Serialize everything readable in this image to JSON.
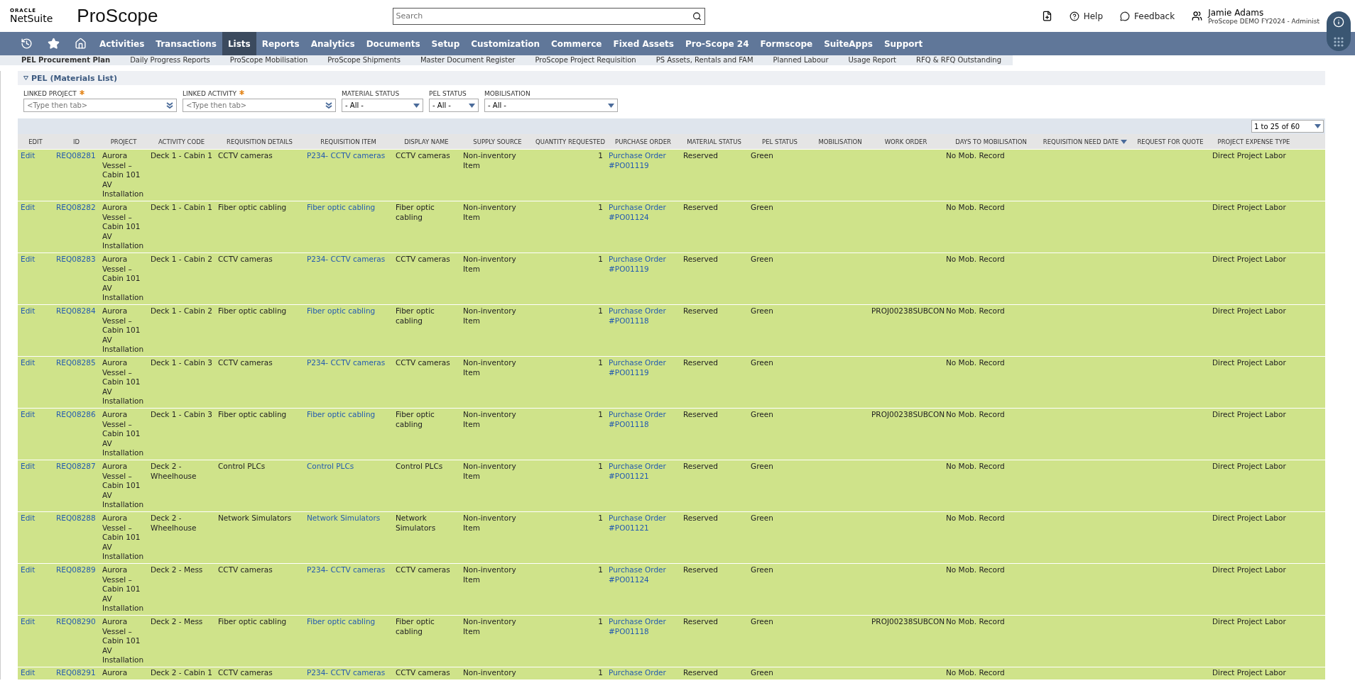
{
  "header": {
    "brand_top": "ORACLE",
    "brand_bottom": "NetSuite",
    "app_logo": "ProScope",
    "search": {
      "placeholder": "Search"
    },
    "help": "Help",
    "feedback": "Feedback",
    "user": {
      "name": "Jamie Adams",
      "role": "ProScope DEMO FY2024 - Administ"
    }
  },
  "nav": [
    {
      "label": "Activities",
      "selected": false
    },
    {
      "label": "Transactions",
      "selected": false
    },
    {
      "label": "Lists",
      "selected": true
    },
    {
      "label": "Reports",
      "selected": false
    },
    {
      "label": "Analytics",
      "selected": false
    },
    {
      "label": "Documents",
      "selected": false
    },
    {
      "label": "Setup",
      "selected": false
    },
    {
      "label": "Customization",
      "selected": false
    },
    {
      "label": "Commerce",
      "selected": false
    },
    {
      "label": "Fixed Assets",
      "selected": false
    },
    {
      "label": "Pro-Scope 24",
      "selected": false
    },
    {
      "label": "Formscope",
      "selected": false
    },
    {
      "label": "SuiteApps",
      "selected": false
    },
    {
      "label": "Support",
      "selected": false
    }
  ],
  "subnav": [
    {
      "label": "PEL Procurement Plan",
      "selected": true
    },
    {
      "label": "Daily Progress Reports",
      "selected": false
    },
    {
      "label": "ProScope Mobilisation",
      "selected": false
    },
    {
      "label": "ProScope Shipments",
      "selected": false
    },
    {
      "label": "Master Document Register",
      "selected": false
    },
    {
      "label": "ProScope Project Requisition",
      "selected": false
    },
    {
      "label": "PS Assets, Rentals and FAM",
      "selected": false
    },
    {
      "label": "Planned Labour",
      "selected": false
    },
    {
      "label": "Usage Report",
      "selected": false
    },
    {
      "label": "RFQ & RFQ Outstanding",
      "selected": false
    }
  ],
  "section": {
    "title": "PEL (Materials List)",
    "expanded": true
  },
  "filters": [
    {
      "label": "LINKED PROJECT",
      "required": true,
      "kind": "lookup",
      "placeholder": "<Type then tab>"
    },
    {
      "label": "LINKED ACTIVITY",
      "required": true,
      "kind": "lookup",
      "placeholder": "<Type then tab>"
    },
    {
      "label": "MATERIAL STATUS",
      "required": false,
      "kind": "select",
      "value": "- All -"
    },
    {
      "label": "PEL STATUS",
      "required": false,
      "kind": "select",
      "value": "- All -"
    },
    {
      "label": "MOBILISATION",
      "required": false,
      "kind": "select",
      "value": "- All -"
    }
  ],
  "pagination": "1 to 25 of 60",
  "table": {
    "columns": [
      {
        "label": "EDIT",
        "kind": "link"
      },
      {
        "label": "ID",
        "kind": "link"
      },
      {
        "label": "PROJECT",
        "kind": "text"
      },
      {
        "label": "ACTIVITY CODE",
        "kind": "text"
      },
      {
        "label": "REQUISITION DETAILS",
        "kind": "text"
      },
      {
        "label": "REQUISITION ITEM",
        "kind": "link"
      },
      {
        "label": "DISPLAY NAME",
        "kind": "text"
      },
      {
        "label": "SUPPLY SOURCE",
        "kind": "text"
      },
      {
        "label": "QUANTITY REQUESTED",
        "kind": "number"
      },
      {
        "label": "PURCHASE ORDER",
        "kind": "link"
      },
      {
        "label": "MATERIAL STATUS",
        "kind": "text"
      },
      {
        "label": "PEL STATUS",
        "kind": "text"
      },
      {
        "label": "MOBILISATION",
        "kind": "text"
      },
      {
        "label": "WORK ORDER",
        "kind": "text"
      },
      {
        "label": "DAYS TO MOBILISATION",
        "kind": "text"
      },
      {
        "label": "REQUISITION NEED DATE",
        "kind": "text",
        "sorted": true
      },
      {
        "label": "REQUEST FOR QUOTE",
        "kind": "text"
      },
      {
        "label": "PROJECT EXPENSE TYPE",
        "kind": "text"
      }
    ],
    "rows": [
      {
        "cells": [
          "Edit",
          "REQ08281",
          "Aurora Vessel – Cabin 101 AV Installation",
          "Deck 1 - Cabin 1",
          "CCTV cameras",
          "P234- CCTV cameras",
          "CCTV cameras",
          "Non-inventory Item",
          "1",
          "Purchase Order #PO01119",
          "Reserved",
          "Green",
          null,
          null,
          "No Mob. Record",
          null,
          null,
          "Direct Project Labor"
        ]
      },
      {
        "cells": [
          "Edit",
          "REQ08282",
          "Aurora Vessel – Cabin 101 AV Installation",
          "Deck 1 - Cabin 1",
          "Fiber optic cabling",
          "Fiber optic cabling",
          "Fiber optic cabling",
          "Non-inventory Item",
          "1",
          "Purchase Order #PO01124",
          "Reserved",
          "Green",
          null,
          null,
          "No Mob. Record",
          null,
          null,
          "Direct Project Labor"
        ]
      },
      {
        "cells": [
          "Edit",
          "REQ08283",
          "Aurora Vessel – Cabin 101 AV Installation",
          "Deck 1 - Cabin 2",
          "CCTV cameras",
          "P234- CCTV cameras",
          "CCTV cameras",
          "Non-inventory Item",
          "1",
          "Purchase Order #PO01119",
          "Reserved",
          "Green",
          null,
          null,
          "No Mob. Record",
          null,
          null,
          "Direct Project Labor"
        ]
      },
      {
        "cells": [
          "Edit",
          "REQ08284",
          "Aurora Vessel – Cabin 101 AV Installation",
          "Deck 1 - Cabin 2",
          "Fiber optic cabling",
          "Fiber optic cabling",
          "Fiber optic cabling",
          "Non-inventory Item",
          "1",
          "Purchase Order #PO01118",
          "Reserved",
          "Green",
          null,
          "PROJ00238SUBCON",
          "No Mob. Record",
          null,
          null,
          "Direct Project Labor"
        ]
      },
      {
        "cells": [
          "Edit",
          "REQ08285",
          "Aurora Vessel – Cabin 101 AV Installation",
          "Deck 1 - Cabin 3",
          "CCTV cameras",
          "P234- CCTV cameras",
          "CCTV cameras",
          "Non-inventory Item",
          "1",
          "Purchase Order #PO01119",
          "Reserved",
          "Green",
          null,
          null,
          "No Mob. Record",
          null,
          null,
          "Direct Project Labor"
        ]
      },
      {
        "cells": [
          "Edit",
          "REQ08286",
          "Aurora Vessel – Cabin 101 AV Installation",
          "Deck 1 - Cabin 3",
          "Fiber optic cabling",
          "Fiber optic cabling",
          "Fiber optic cabling",
          "Non-inventory Item",
          "1",
          "Purchase Order #PO01118",
          "Reserved",
          "Green",
          null,
          "PROJ00238SUBCON",
          "No Mob. Record",
          null,
          null,
          "Direct Project Labor"
        ]
      },
      {
        "cells": [
          "Edit",
          "REQ08287",
          "Aurora Vessel – Cabin 101 AV Installation",
          "Deck 2 - Wheelhouse",
          "Control PLCs",
          "Control PLCs",
          "Control PLCs",
          "Non-inventory Item",
          "1",
          "Purchase Order #PO01121",
          "Reserved",
          "Green",
          null,
          null,
          "No Mob. Record",
          null,
          null,
          "Direct Project Labor"
        ]
      },
      {
        "cells": [
          "Edit",
          "REQ08288",
          "Aurora Vessel – Cabin 101 AV Installation",
          "Deck 2 - Wheelhouse",
          "Network Simulators",
          "Network Simulators",
          "Network Simulators",
          "Non-inventory Item",
          "1",
          "Purchase Order #PO01121",
          "Reserved",
          "Green",
          null,
          null,
          "No Mob. Record",
          null,
          null,
          "Direct Project Labor"
        ]
      },
      {
        "cells": [
          "Edit",
          "REQ08289",
          "Aurora Vessel – Cabin 101 AV Installation",
          "Deck 2 - Mess",
          "CCTV cameras",
          "P234- CCTV cameras",
          "CCTV cameras",
          "Non-inventory Item",
          "1",
          "Purchase Order #PO01124",
          "Reserved",
          "Green",
          null,
          null,
          "No Mob. Record",
          null,
          null,
          "Direct Project Labor"
        ]
      },
      {
        "cells": [
          "Edit",
          "REQ08290",
          "Aurora Vessel – Cabin 101 AV Installation",
          "Deck 2 - Mess",
          "Fiber optic cabling",
          "Fiber optic cabling",
          "Fiber optic cabling",
          "Non-inventory Item",
          "1",
          "Purchase Order #PO01118",
          "Reserved",
          "Green",
          null,
          "PROJ00238SUBCON",
          "No Mob. Record",
          null,
          null,
          "Direct Project Labor"
        ]
      },
      {
        "cells": [
          "Edit",
          "REQ08291",
          "Aurora",
          "Deck 2 - Cabin 1",
          "CCTV cameras",
          "P234- CCTV cameras",
          "CCTV cameras",
          "Non-inventory",
          "1",
          "Purchase Order",
          "Reserved",
          "Green",
          null,
          null,
          "No Mob. Record",
          null,
          null,
          "Direct Project Labor"
        ]
      }
    ]
  }
}
